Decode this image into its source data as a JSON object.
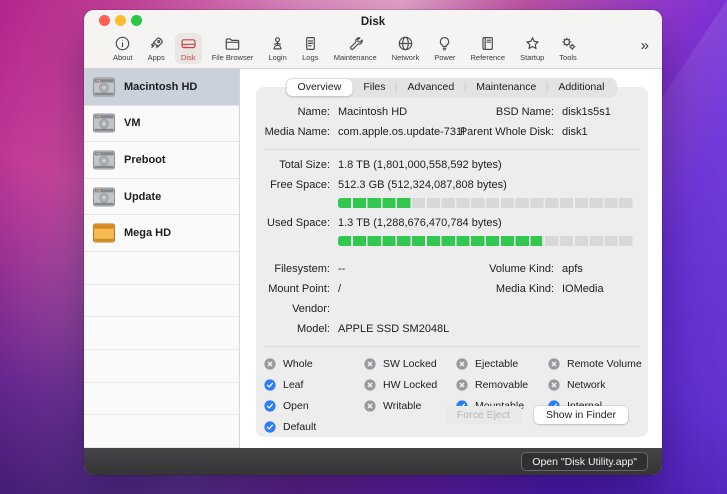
{
  "colors": {
    "accent_green": "#32c74f",
    "accent_blue": "#2a7cf7",
    "disk_red": "#c8453c",
    "selected_row": "#cbd1da"
  },
  "window": {
    "title": "Disk"
  },
  "toolbar": {
    "overflow_label": "»",
    "items": [
      {
        "label": "About",
        "icon": "info-icon",
        "selected": false
      },
      {
        "label": "Apps",
        "icon": "rocket-icon",
        "selected": false
      },
      {
        "label": "Disk",
        "icon": "disk-icon",
        "selected": true
      },
      {
        "label": "File Browser",
        "icon": "folder-icon",
        "selected": false
      },
      {
        "label": "Login",
        "icon": "login-icon",
        "selected": false
      },
      {
        "label": "Logs",
        "icon": "document-icon",
        "selected": false
      },
      {
        "label": "Maintenance",
        "icon": "wrench-icon",
        "selected": false
      },
      {
        "label": "Network",
        "icon": "globe-icon",
        "selected": false
      },
      {
        "label": "Power",
        "icon": "lightbulb-icon",
        "selected": false
      },
      {
        "label": "Reference",
        "icon": "book-icon",
        "selected": false
      },
      {
        "label": "Startup",
        "icon": "star-icon",
        "selected": false
      },
      {
        "label": "Tools",
        "icon": "gears-icon",
        "selected": false
      }
    ]
  },
  "sidebar": {
    "items": [
      {
        "label": "Macintosh HD",
        "icon": "internal-drive-icon",
        "selected": true
      },
      {
        "label": "VM",
        "icon": "internal-drive-icon",
        "selected": false
      },
      {
        "label": "Preboot",
        "icon": "internal-drive-icon",
        "selected": false
      },
      {
        "label": "Update",
        "icon": "internal-drive-icon",
        "selected": false
      },
      {
        "label": "Mega HD",
        "icon": "external-drive-icon",
        "selected": false
      }
    ]
  },
  "tabs": [
    {
      "label": "Overview",
      "selected": true
    },
    {
      "label": "Files",
      "selected": false
    },
    {
      "label": "Advanced",
      "selected": false
    },
    {
      "label": "Maintenance",
      "selected": false
    },
    {
      "label": "Additional",
      "selected": false
    }
  ],
  "overview": {
    "rows": [
      {
        "type": "pair",
        "left": {
          "label": "Name:",
          "value": "Macintosh HD"
        },
        "right": {
          "label": "BSD Name:",
          "value": "disk1s5s1"
        }
      },
      {
        "type": "pair",
        "left": {
          "label": "Media Name:",
          "value": "com.apple.os.update-731l"
        },
        "right": {
          "label": "Parent Whole Disk:",
          "value": "disk1"
        }
      },
      {
        "type": "divider"
      },
      {
        "type": "pair",
        "left": {
          "label": "Total Size:",
          "value": "1.8 TB (1,801,000,558,592 bytes)"
        }
      },
      {
        "type": "pair",
        "left": {
          "label": "Free Space:",
          "value": "512.3 GB (512,324,087,808 bytes)"
        }
      },
      {
        "type": "bar",
        "percent": 25
      },
      {
        "type": "pair",
        "left": {
          "label": "Used Space:",
          "value": "1.3 TB (1,288,676,470,784 bytes)"
        }
      },
      {
        "type": "bar",
        "percent": 69
      },
      {
        "type": "spacer"
      },
      {
        "type": "pair",
        "left": {
          "label": "Filesystem:",
          "value": "--"
        },
        "right": {
          "label": "Volume Kind:",
          "value": "apfs"
        }
      },
      {
        "type": "pair",
        "left": {
          "label": "Mount Point:",
          "value": "/"
        },
        "right": {
          "label": "Media Kind:",
          "value": "IOMedia"
        }
      },
      {
        "type": "pair",
        "left": {
          "label": "Vendor:",
          "value": ""
        }
      },
      {
        "type": "pair",
        "left": {
          "label": "Model:",
          "value": "APPLE SSD SM2048L"
        }
      },
      {
        "type": "divider"
      }
    ],
    "flags_columns": [
      [
        {
          "label": "Whole",
          "checked": false
        },
        {
          "label": "Leaf",
          "checked": true
        },
        {
          "label": "Open",
          "checked": true
        },
        {
          "label": "Default",
          "checked": true
        }
      ],
      [
        {
          "label": "SW Locked",
          "checked": false
        },
        {
          "label": "HW Locked",
          "checked": false
        },
        {
          "label": "Writable",
          "checked": false
        }
      ],
      [
        {
          "label": "Ejectable",
          "checked": false
        },
        {
          "label": "Removable",
          "checked": false
        },
        {
          "label": "Mountable",
          "checked": true
        }
      ],
      [
        {
          "label": "Remote Volume",
          "checked": false
        },
        {
          "label": "Network",
          "checked": false
        },
        {
          "label": "Internal",
          "checked": true
        }
      ]
    ],
    "buttons": [
      {
        "label": "Force Eject",
        "disabled": true
      },
      {
        "label": "Show in Finder",
        "disabled": false
      }
    ]
  },
  "statusbar": {
    "open_button": "Open \"Disk Utility.app\""
  }
}
